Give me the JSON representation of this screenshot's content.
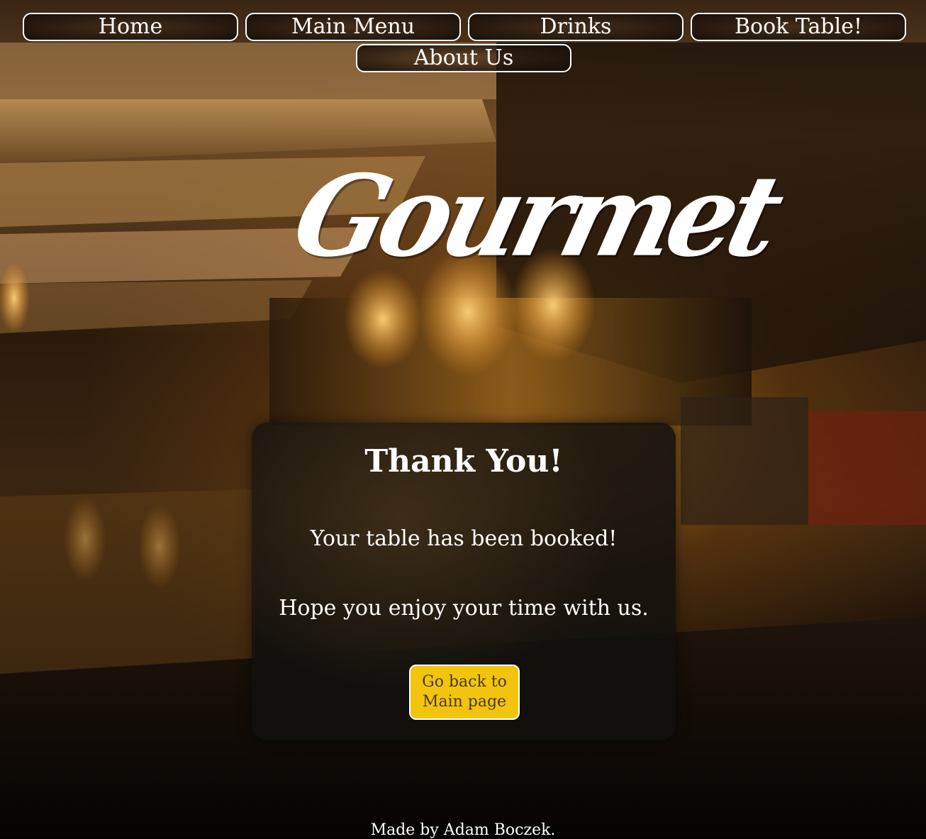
{
  "nav": {
    "items": [
      {
        "label": "Home"
      },
      {
        "label": "Main Menu"
      },
      {
        "label": "Drinks"
      },
      {
        "label": "Book Table!"
      },
      {
        "label": "About Us"
      }
    ]
  },
  "logo": {
    "text": "Gourmet"
  },
  "card": {
    "title": "Thank You!",
    "line1": "Your table has been booked!",
    "line2": "Hope you enjoy your time with us.",
    "button_line1": "Go back to",
    "button_line2": "Main page"
  },
  "footer": {
    "text": "Made by Adam Boczek."
  },
  "colors": {
    "accent_button": "#f2c40d",
    "accent_button_text": "#4a3a10",
    "nav_border": "#ffffff",
    "card_background": "#121010"
  }
}
